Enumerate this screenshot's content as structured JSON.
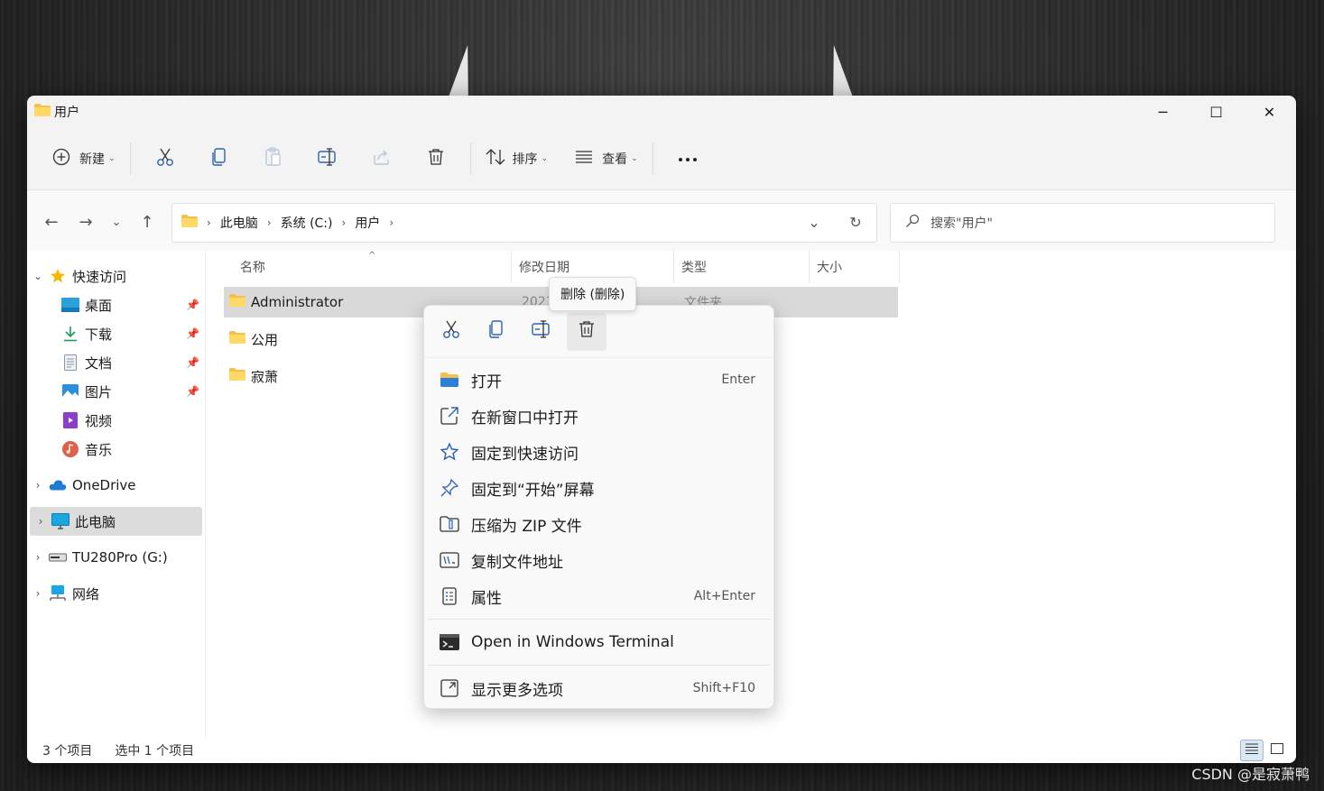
{
  "window": {
    "title": "用户"
  },
  "toolbar": {
    "new_label": "新建",
    "sort_label": "排序",
    "view_label": "查看"
  },
  "address": {
    "crumbs": [
      "此电脑",
      "系统 (C:)",
      "用户"
    ]
  },
  "search": {
    "placeholder": "搜索\"用户\""
  },
  "sidebar": {
    "quick_access": "快速访问",
    "items": [
      "桌面",
      "下载",
      "文档",
      "图片",
      "视频",
      "音乐"
    ],
    "onedrive": "OneDrive",
    "this_pc": "此电脑",
    "drive": "TU280Pro (G:)",
    "network": "网络"
  },
  "columns": {
    "name": "名称",
    "date": "修改日期",
    "type": "类型",
    "size": "大小"
  },
  "files": [
    {
      "name": "Administrator",
      "date": "2021",
      "type": "文件夹"
    },
    {
      "name": "公用"
    },
    {
      "name": "寂萧"
    }
  ],
  "status": {
    "count": "3 个项目",
    "selected": "选中 1 个项目"
  },
  "tooltip": "删除 (删除)",
  "context_menu": {
    "items": [
      {
        "label": "打开",
        "shortcut": "Enter"
      },
      {
        "label": "在新窗口中打开"
      },
      {
        "label": "固定到快速访问"
      },
      {
        "label": "固定到“开始”屏幕"
      },
      {
        "label": "压缩为 ZIP 文件"
      },
      {
        "label": "复制文件地址"
      },
      {
        "label": "属性",
        "shortcut": "Alt+Enter"
      }
    ],
    "terminal": "Open in Windows Terminal",
    "more": {
      "label": "显示更多选项",
      "shortcut": "Shift+F10"
    }
  },
  "watermark": "CSDN @是寂萧鸭",
  "colors": {
    "accent": "#0a5fb4",
    "folder": "#f4c04a"
  }
}
